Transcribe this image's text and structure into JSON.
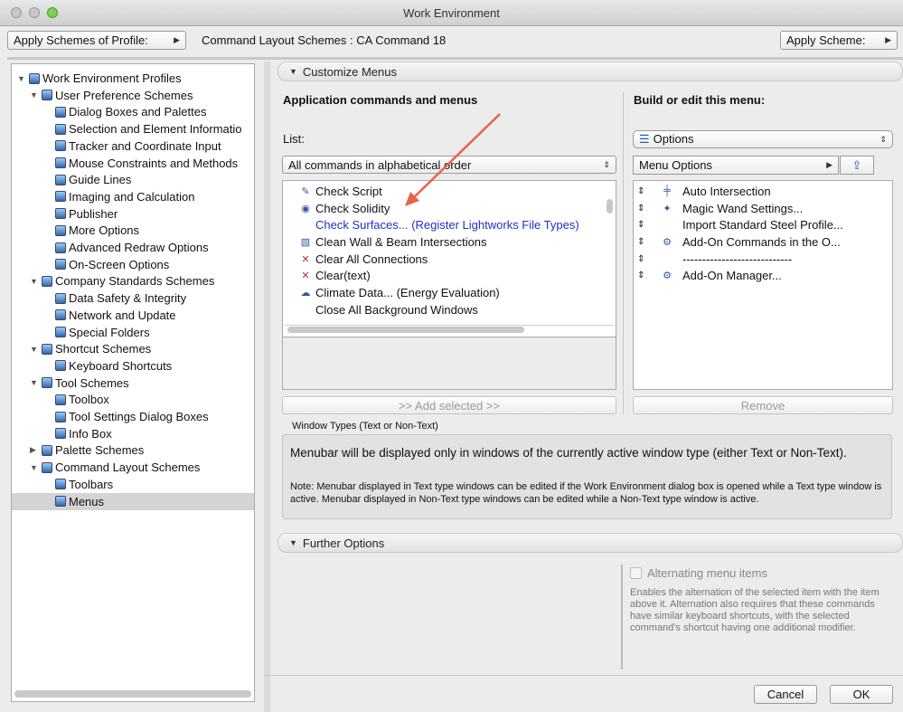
{
  "window": {
    "title": "Work Environment"
  },
  "toolbar": {
    "apply_profile": "Apply Schemes of Profile:",
    "scheme_label": "Command Layout Schemes : CA Command 18",
    "apply_scheme": "Apply Scheme:"
  },
  "tree": [
    {
      "label": "Work Environment Profiles",
      "level": 0,
      "expanded": true
    },
    {
      "label": "User Preference Schemes",
      "level": 1,
      "expanded": true
    },
    {
      "label": "Dialog Boxes and Palettes",
      "level": 2
    },
    {
      "label": "Selection and Element Informatio",
      "level": 2
    },
    {
      "label": "Tracker and Coordinate Input",
      "level": 2
    },
    {
      "label": "Mouse Constraints and Methods",
      "level": 2
    },
    {
      "label": "Guide Lines",
      "level": 2
    },
    {
      "label": "Imaging and Calculation",
      "level": 2
    },
    {
      "label": "Publisher",
      "level": 2
    },
    {
      "label": "More Options",
      "level": 2
    },
    {
      "label": "Advanced Redraw Options",
      "level": 2
    },
    {
      "label": "On-Screen Options",
      "level": 2
    },
    {
      "label": "Company Standards Schemes",
      "level": 1,
      "expanded": true
    },
    {
      "label": "Data Safety & Integrity",
      "level": 2
    },
    {
      "label": "Network and Update",
      "level": 2
    },
    {
      "label": "Special Folders",
      "level": 2
    },
    {
      "label": "Shortcut Schemes",
      "level": 1,
      "expanded": true
    },
    {
      "label": "Keyboard Shortcuts",
      "level": 2
    },
    {
      "label": "Tool Schemes",
      "level": 1,
      "expanded": true
    },
    {
      "label": "Toolbox",
      "level": 2
    },
    {
      "label": "Tool Settings Dialog Boxes",
      "level": 2
    },
    {
      "label": "Info Box",
      "level": 2
    },
    {
      "label": "Palette Schemes",
      "level": 1
    },
    {
      "label": "Command Layout Schemes",
      "level": 1,
      "expanded": true
    },
    {
      "label": "Toolbars",
      "level": 2
    },
    {
      "label": "Menus",
      "level": 2,
      "selected": true
    }
  ],
  "customize": {
    "header": "Customize Menus",
    "left_title": "Application commands and menus",
    "list_label": "List:",
    "list_select": "All commands in alphabetical order",
    "commands": [
      {
        "label": "Check Script",
        "icon": "script-check-icon"
      },
      {
        "label": "Check Solidity",
        "icon": "solidity-icon"
      },
      {
        "label": "Check Surfaces... (Register Lightworks File Types)",
        "icon": "",
        "blue": true
      },
      {
        "label": "Clean Wall & Beam Intersections",
        "icon": "clean-intersections-icon"
      },
      {
        "label": "Clear All Connections",
        "icon": "clear-connections-icon"
      },
      {
        "label": "Clear(text)",
        "icon": "clear-x-icon"
      },
      {
        "label": "Climate Data... (Energy Evaluation)",
        "icon": "climate-icon"
      },
      {
        "label": "Close All Background Windows",
        "icon": ""
      }
    ],
    "add_selected": ">> Add selected >>",
    "right_title": "Build or edit this menu:",
    "menu_select": "Options",
    "submenu": "Menu Options",
    "menu_items": [
      {
        "label": "Auto Intersection",
        "icon": "auto-intersection-icon"
      },
      {
        "label": "Magic Wand Settings...",
        "icon": "magic-wand-icon"
      },
      {
        "label": "Import Standard Steel Profile...",
        "icon": ""
      },
      {
        "label": "Add-On Commands in the O...",
        "icon": "addon-commands-icon"
      },
      {
        "label": "----------------------------",
        "icon": ""
      },
      {
        "label": "Add-On Manager...",
        "icon": "addon-manager-icon"
      }
    ],
    "remove": "Remove"
  },
  "window_types": {
    "label": "Window Types (Text or Non-Text)",
    "main": "Menubar will be displayed only in windows of the currently active window type (either Text or Non-Text).",
    "note": "Note: Menubar displayed in Text type windows can be edited if the Work Environment dialog box is opened while a Text type window is active. Menubar displayed in Non-Text type windows can be edited while a Non-Text type window is active."
  },
  "further": {
    "header": "Further Options",
    "checkbox": "Alternating menu items",
    "checked": false,
    "description": "Enables the alternation of the selected item with the item above it. Alternation also requires that these commands have similar keyboard shortcuts, with the selected command's shortcut having one additional modifier."
  },
  "footer": {
    "cancel": "Cancel",
    "ok": "OK"
  },
  "colors": {
    "link_blue": "#2030c8",
    "arrow": "#e8624a",
    "selection": "#d4d4d4"
  }
}
